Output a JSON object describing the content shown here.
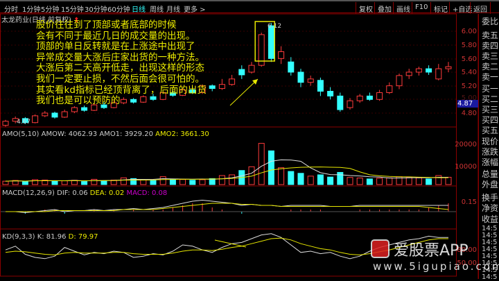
{
  "toolbar": {
    "tabs": [
      "分时",
      "1分钟",
      "5分钟",
      "15分钟",
      "30分钟",
      "60分钟",
      "日线",
      "周线",
      "月线",
      "更多 >"
    ],
    "active": "日线",
    "buttons": [
      "复权",
      "叠加",
      "画线",
      "F10",
      "标记",
      "+自选",
      "返回"
    ]
  },
  "title": "太龙药业(日线,前复权)",
  "annotation": [
    "股价往往到了顶部或者底部的时候",
    "会有不同于最近几日的成交量的出现。",
    "顶部的单日反转就是在上涨途中出现了",
    "异常成交量大涨后庄家出货的一种方法。",
    "大涨后第二天高开低走，出现这样的形态",
    "我们一定要止损，不然后面会很可怕的。",
    "其实看kd指标已经顶背离了，后面的出货",
    "我们也是可以预防的"
  ],
  "price_marks": {
    "high": "6.12",
    "low": "4.67",
    "current": "4.87"
  },
  "price_axis": [
    "6.00",
    "5.80",
    "5.60",
    "5.40",
    "5.20",
    "5.00",
    "4.80"
  ],
  "amo": {
    "label": "AMO(5,10)",
    "amow": "AMOW: 4062.93",
    "amo1": "AMO1: 3929.20",
    "amo2": "AMO2: 3661.30",
    "axis": [
      "20000",
      "10000"
    ]
  },
  "macd": {
    "label": "MACD(12,26,9)",
    "dif": "DIF: 0.06",
    "dea": "DEA: 0.02",
    "macd": "MACD: 0.08",
    "axis": "0.15"
  },
  "kd": {
    "label": "KD(9,3,3)",
    "k": "K: 81.96",
    "d": "D: 79.97",
    "axis": [
      "80.00",
      "50.00"
    ]
  },
  "side": {
    "labels": [
      "委比",
      "卖五",
      "卖四",
      "卖三",
      "卖二",
      "卖一",
      "买一",
      "买二",
      "买三",
      "买四",
      "买五",
      "现价",
      "涨跌",
      "涨幅",
      "总量",
      "外盘",
      "换手",
      "净资",
      "收益"
    ],
    "times": [
      "14:5",
      "14:5",
      "14:5",
      "14:5",
      "14:5",
      "14:5",
      "14:5",
      "14:5"
    ]
  },
  "watermark": {
    "brand": "爱股票APP",
    "url": "www.5igupiao.com"
  },
  "colors": {
    "up": "#ff3b3b",
    "down": "#33ffff",
    "yellow": "#e8e800",
    "grid": "#8b0000"
  },
  "chart_data": {
    "type": "candlestick",
    "ohlc": [
      [
        4.62,
        4.7,
        4.6,
        4.68
      ],
      [
        4.68,
        4.75,
        4.65,
        4.72
      ],
      [
        4.72,
        4.74,
        4.64,
        4.66
      ],
      [
        4.66,
        4.78,
        4.65,
        4.76
      ],
      [
        4.76,
        4.83,
        4.74,
        4.8
      ],
      [
        4.8,
        4.82,
        4.72,
        4.74
      ],
      [
        4.74,
        4.85,
        4.73,
        4.82
      ],
      [
        4.82,
        4.9,
        4.8,
        4.88
      ],
      [
        4.88,
        4.91,
        4.82,
        4.84
      ],
      [
        4.84,
        4.95,
        4.83,
        4.92
      ],
      [
        4.92,
        4.96,
        4.86,
        4.88
      ],
      [
        4.88,
        4.98,
        4.87,
        4.95
      ],
      [
        4.95,
        5.03,
        4.93,
        5.0
      ],
      [
        5.0,
        5.02,
        4.94,
        4.96
      ],
      [
        4.96,
        5.06,
        4.95,
        5.04
      ],
      [
        5.04,
        5.08,
        4.98,
        5.0
      ],
      [
        5.0,
        5.12,
        4.99,
        5.1
      ],
      [
        5.1,
        5.13,
        5.04,
        5.06
      ],
      [
        5.06,
        5.16,
        5.05,
        5.14
      ],
      [
        5.14,
        5.18,
        5.08,
        5.1
      ],
      [
        5.1,
        5.22,
        5.08,
        5.2
      ],
      [
        5.2,
        5.22,
        5.12,
        5.16
      ],
      [
        5.16,
        5.3,
        5.14,
        5.22
      ],
      [
        5.22,
        5.36,
        5.2,
        5.3
      ],
      [
        5.44,
        5.5,
        5.3,
        5.36
      ],
      [
        5.4,
        5.55,
        5.38,
        5.5
      ],
      [
        5.5,
        5.98,
        5.48,
        5.95
      ],
      [
        6.08,
        6.12,
        5.55,
        5.6
      ],
      [
        5.6,
        5.78,
        5.52,
        5.7
      ],
      [
        5.55,
        5.62,
        5.35,
        5.4
      ],
      [
        5.4,
        5.45,
        5.18,
        5.25
      ],
      [
        5.25,
        5.35,
        5.2,
        5.3
      ],
      [
        5.28,
        5.32,
        5.05,
        5.12
      ],
      [
        5.12,
        5.18,
        5.0,
        5.05
      ],
      [
        5.05,
        5.1,
        4.82,
        4.85
      ],
      [
        4.88,
        5.02,
        4.85,
        4.98
      ],
      [
        4.98,
        5.08,
        4.95,
        5.05
      ],
      [
        5.05,
        5.1,
        4.98,
        5.0
      ],
      [
        5.0,
        5.14,
        4.98,
        5.1
      ],
      [
        5.1,
        5.25,
        5.08,
        5.2
      ],
      [
        5.2,
        5.38,
        5.15,
        5.35
      ],
      [
        5.35,
        5.45,
        5.3,
        5.4
      ],
      [
        5.4,
        5.48,
        5.35,
        5.45
      ],
      [
        5.45,
        5.5,
        5.36,
        5.4
      ],
      [
        5.3,
        5.52,
        5.28,
        5.45
      ],
      [
        5.45,
        5.55,
        5.4,
        5.48
      ]
    ],
    "volume": [
      1800,
      2200,
      1500,
      2600,
      2400,
      1700,
      2000,
      2300,
      1600,
      2800,
      2000,
      2400,
      3600,
      3200,
      2500,
      2200,
      4200,
      3000,
      2700,
      2300,
      2600,
      3200,
      4800,
      5200,
      7500,
      9500,
      22000,
      18000,
      9000,
      7000,
      6000,
      4500,
      5200,
      4000,
      6500,
      3800,
      3500,
      3000,
      3400,
      3600,
      4200,
      3800,
      3600,
      3000,
      4800,
      3900
    ],
    "kd_k": [
      62,
      68,
      55,
      50,
      48,
      52,
      66,
      60,
      54,
      58,
      56,
      60,
      58,
      50,
      52,
      56,
      54,
      60,
      70,
      68,
      62,
      58,
      66,
      72,
      74,
      80,
      86,
      88,
      82,
      70,
      58,
      60,
      56,
      58,
      52,
      48,
      52,
      60,
      66,
      70,
      74,
      78,
      80,
      84,
      82,
      82
    ],
    "kd_d": [
      58,
      60,
      59,
      57,
      55,
      54,
      57,
      58,
      57,
      57,
      57,
      58,
      58,
      56,
      55,
      55,
      55,
      57,
      60,
      62,
      62,
      61,
      63,
      66,
      68,
      72,
      76,
      80,
      81,
      78,
      72,
      68,
      64,
      62,
      58,
      55,
      54,
      56,
      59,
      62,
      66,
      70,
      74,
      78,
      80,
      80
    ],
    "macd_dif": [
      0,
      0,
      -0.01,
      0,
      0.01,
      0.02,
      0,
      0.01,
      0.01,
      0.02,
      0.01,
      0.02,
      0.02,
      0.03,
      0.02,
      0.03,
      0.04,
      0.06,
      0.08,
      0.1,
      0.11,
      0.1,
      0.09,
      0.08,
      0.06,
      0.07,
      0.06,
      0.06,
      0.05,
      0.06,
      0.06,
      0.06,
      0.06,
      0.05,
      0.05,
      0.05,
      0.06,
      0.06,
      0.06,
      0.06,
      0.06,
      0.06,
      0.06,
      0.06,
      0.06,
      0.06
    ],
    "macd_dea": [
      0,
      0,
      0,
      0,
      0,
      0.01,
      0.01,
      0.01,
      0.01,
      0.01,
      0.01,
      0.01,
      0.02,
      0.02,
      0.02,
      0.02,
      0.03,
      0.04,
      0.05,
      0.06,
      0.07,
      0.08,
      0.08,
      0.08,
      0.07,
      0.07,
      0.06,
      0.06,
      0.05,
      0.05,
      0.05,
      0.05,
      0.05,
      0.05,
      0.05,
      0.05,
      0.05,
      0.05,
      0.05,
      0.05,
      0.05,
      0.05,
      0.05,
      0.04,
      0.03,
      0.02
    ]
  }
}
